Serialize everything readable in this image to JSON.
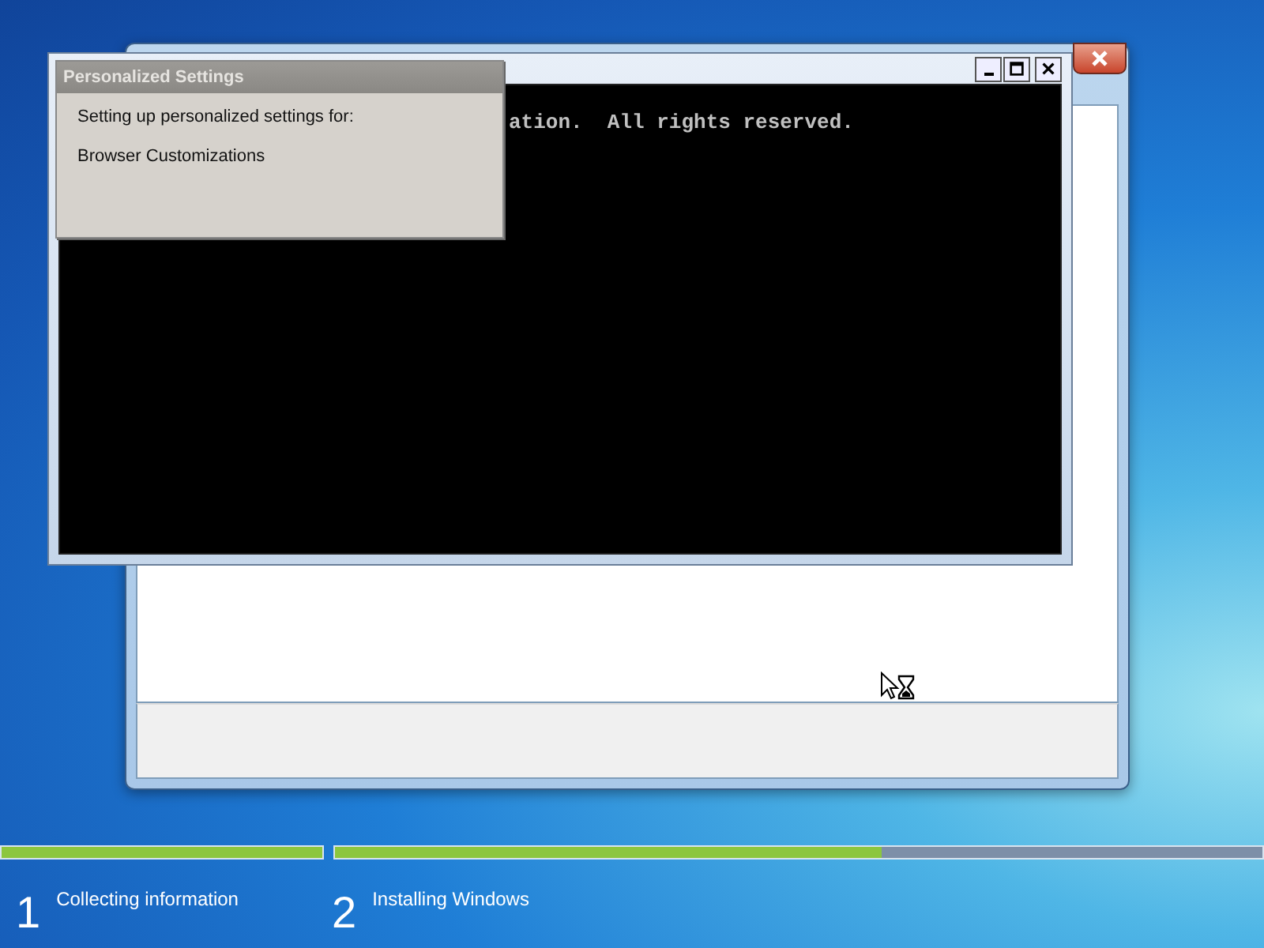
{
  "console_window": {
    "text": "ation.  All rights reserved."
  },
  "dialog": {
    "title": "Personalized Settings",
    "lines": [
      "Setting up personalized settings for:",
      "Browser Customizations"
    ]
  },
  "progress": {
    "steps": [
      {
        "number": "1",
        "label": "Collecting information",
        "level": 1
      },
      {
        "number": "2",
        "label": "Installing Windows",
        "level": 0.59
      }
    ]
  }
}
